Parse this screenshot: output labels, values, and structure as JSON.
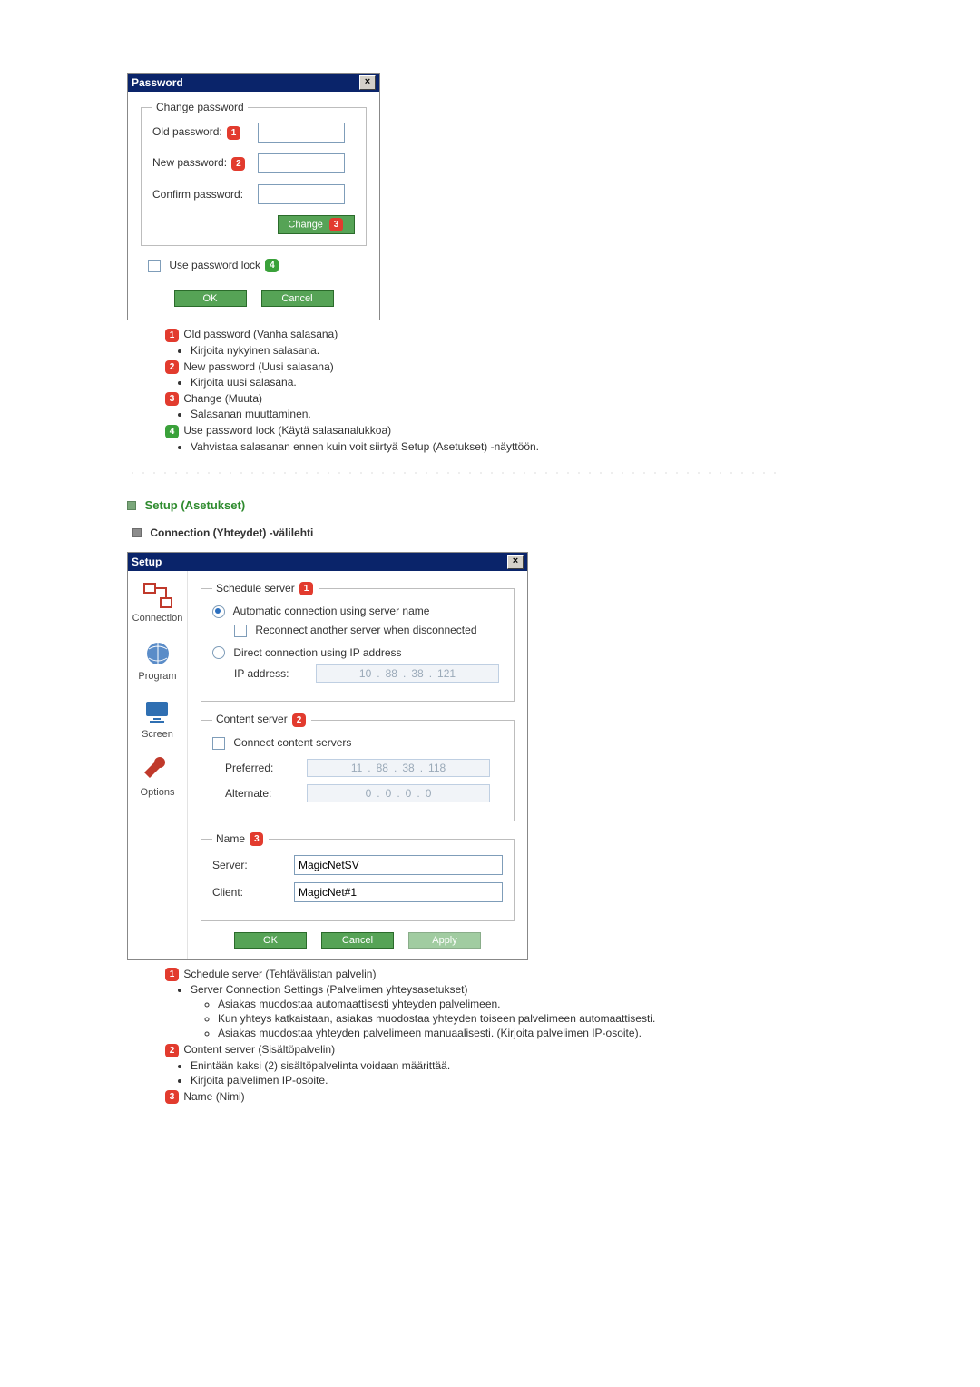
{
  "password_dialog": {
    "title": "Password",
    "group_legend": "Change password",
    "old_label": "Old password:",
    "new_label": "New password:",
    "confirm_label": "Confirm password:",
    "change_btn": "Change",
    "use_lock_label": "Use password lock",
    "ok": "OK",
    "cancel": "Cancel"
  },
  "password_notes": {
    "n1_title": "Old password (Vanha salasana)",
    "n1_b1": "Kirjoita nykyinen salasana.",
    "n2_title": "New password (Uusi salasana)",
    "n2_b1": "Kirjoita uusi salasana.",
    "n3_title": "Change (Muuta)",
    "n3_b1": "Salasanan muuttaminen.",
    "n4_title": "Use password lock (Käytä salasanalukkoa)",
    "n4_b1": "Vahvistaa salasanan ennen kuin voit siirtyä Setup (Asetukset) -näyttöön."
  },
  "section": {
    "setup_heading": "Setup (Asetukset)",
    "connection_tab_heading": "Connection (Yhteydet) -välilehti"
  },
  "setup_dialog": {
    "title": "Setup",
    "side": {
      "connection": "Connection",
      "program": "Program",
      "screen": "Screen",
      "options": "Options"
    },
    "schedule_legend": "Schedule server",
    "auto_conn": "Automatic connection using server name",
    "reconnect": "Reconnect another server when disconnected",
    "direct_conn": "Direct connection using IP address",
    "ip_label": "IP address:",
    "ip_vals": [
      "10",
      "88",
      "38",
      "121"
    ],
    "content_legend": "Content server",
    "connect_content": "Connect content servers",
    "preferred_label": "Preferred:",
    "preferred_vals": [
      "11",
      "88",
      "38",
      "118"
    ],
    "alternate_label": "Alternate:",
    "alternate_vals": [
      "0",
      "0",
      "0",
      "0"
    ],
    "name_legend": "Name",
    "server_label": "Server:",
    "server_val": "MagicNetSV",
    "client_label": "Client:",
    "client_val": "MagicNet#1",
    "ok": "OK",
    "cancel": "Cancel",
    "apply": "Apply"
  },
  "setup_notes": {
    "n1_title": "Schedule server (Tehtävälistan palvelin)",
    "n1_b1": "Server Connection Settings (Palvelimen yhteysasetukset)",
    "n1_b1_1": "Asiakas muodostaa automaattisesti yhteyden palvelimeen.",
    "n1_b1_2": "Kun yhteys katkaistaan, asiakas muodostaa yhteyden toiseen palvelimeen automaattisesti.",
    "n1_b1_3": "Asiakas muodostaa yhteyden palvelimeen manuaalisesti. (Kirjoita palvelimen IP-osoite).",
    "n2_title": "Content server (Sisältöpalvelin)",
    "n2_b1": "Enintään kaksi (2) sisältöpalvelinta voidaan määrittää.",
    "n2_b2": "Kirjoita palvelimen IP-osoite.",
    "n3_title": "Name (Nimi)"
  }
}
